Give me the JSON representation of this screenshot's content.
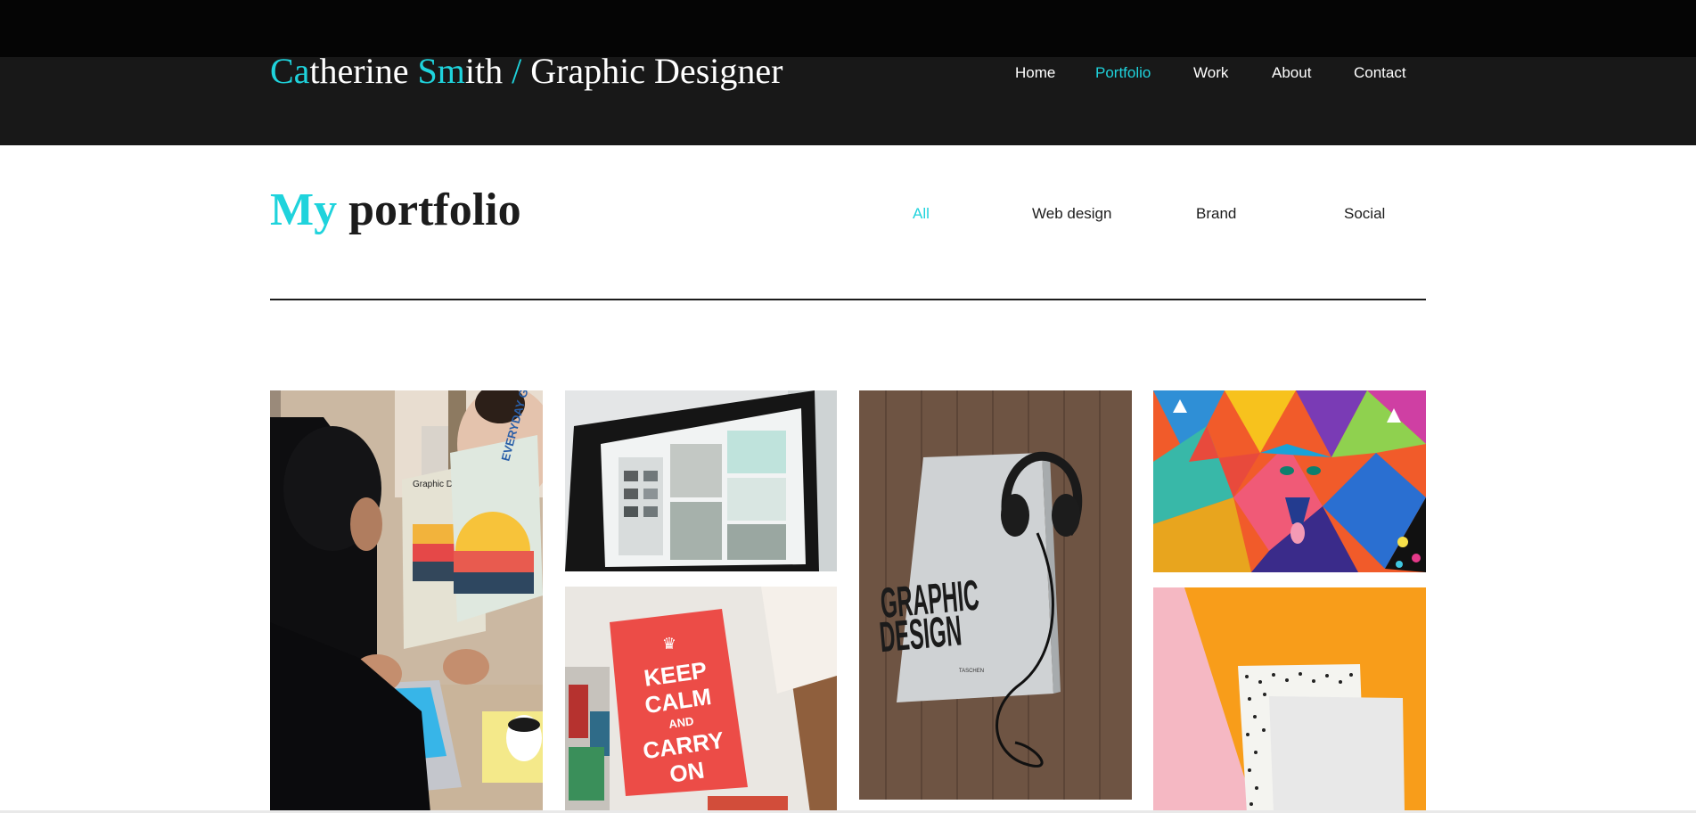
{
  "header": {
    "brand": {
      "p1_accent": "Ca",
      "p1_rest": "therine ",
      "p2_accent": "Sm",
      "p2_rest": "ith",
      "sep": " / ",
      "role": "Graphic Designer"
    },
    "nav": [
      {
        "label": "Home",
        "active": false
      },
      {
        "label": "Portfolio",
        "active": true
      },
      {
        "label": "Work",
        "active": false
      },
      {
        "label": "About",
        "active": false
      },
      {
        "label": "Contact",
        "active": false
      }
    ]
  },
  "portfolio": {
    "title_accent": "My",
    "title_rest": " portfolio",
    "filters": [
      {
        "label": "All",
        "active": true
      },
      {
        "label": "Web design",
        "active": false
      },
      {
        "label": "Brand",
        "active": false
      },
      {
        "label": "Social",
        "active": false
      }
    ],
    "items": [
      {
        "name": "graphic-workshop-photo",
        "book_text": "Graphic Design Workshop",
        "poster_text": "EVERYDAY GRAPHIC"
      },
      {
        "name": "monitor-webdesign-photo"
      },
      {
        "name": "keep-calm-poster-photo",
        "poster_lines": [
          "KEEP",
          "CALM",
          "AND",
          "CARRY",
          "ON"
        ]
      },
      {
        "name": "graphic-design-book-photo",
        "book_lines": [
          "GRAPHIC",
          "DESIGN"
        ],
        "publisher": "TASCHEN"
      },
      {
        "name": "colorful-mural-photo"
      },
      {
        "name": "paper-mockup-photo"
      }
    ]
  },
  "colors": {
    "accent": "#1fd3dc",
    "header_bg": "#181818",
    "top_strip": "#050505",
    "text_dark": "#1c1c1c"
  }
}
